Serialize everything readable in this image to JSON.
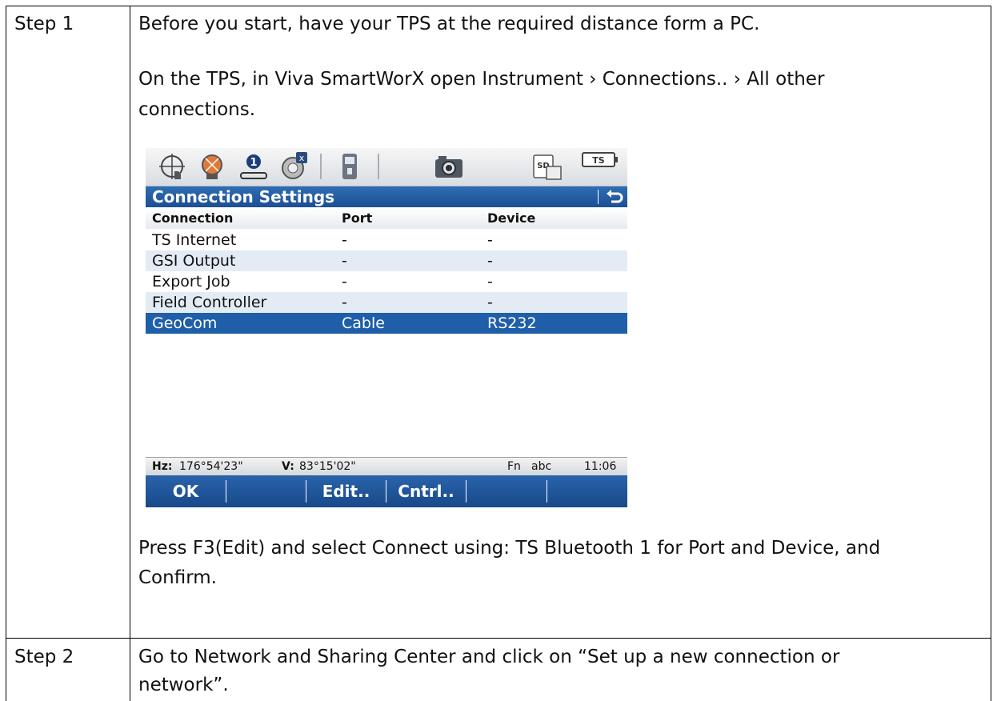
{
  "steps": [
    {
      "label": "Step 1",
      "para1": "Before you start, have your TPS at the required distance form a PC.",
      "para2_line1": "On the TPS, in Viva SmartWorX open Instrument › Connections.. › All other",
      "para2_line2": "connections.",
      "para3_line1": "Press F3(Edit) and select Connect using: TS Bluetooth 1 for Port and Device, and",
      "para3_line2": "Confirm."
    },
    {
      "label": "Step 2",
      "para1_line1": "Go to Network and Sharing Center and click on “Set up a new connection or",
      "para1_line2": "network”."
    }
  ],
  "device": {
    "toolbar_icons": [
      "target-hand-icon",
      "prism-icon",
      "user-1-icon",
      "compass-icon",
      "instrument-icon",
      "camera-icon",
      "sd-card-icon",
      "ts-battery-icon"
    ],
    "ts_badge": "TS",
    "sd_label": "SD",
    "badge_number": "1",
    "title": "Connection Settings",
    "columns": [
      "Connection",
      "Port",
      "Device"
    ],
    "rows": [
      {
        "connection": "TS Internet",
        "port": "-",
        "device": "-"
      },
      {
        "connection": "GSI Output",
        "port": "-",
        "device": "-"
      },
      {
        "connection": "Export Job",
        "port": "-",
        "device": "-"
      },
      {
        "connection": "Field Controller",
        "port": "-",
        "device": "-"
      },
      {
        "connection": "GeoCom",
        "port": "Cable",
        "device": "RS232"
      }
    ],
    "selected_row": 4,
    "status": {
      "hz_label": "Hz:",
      "hz_value": "176°54'23\"",
      "v_label": "V:",
      "v_value": "83°15'02\"",
      "fn": "Fn",
      "abc": "abc",
      "time": "11:06"
    },
    "softkeys": [
      "OK",
      "",
      "Edit..",
      "Cntrl..",
      "",
      ""
    ],
    "colors": {
      "title_bar": "#1f5ea8",
      "selected_row": "#1f5ea8",
      "alt_row": "#e3ebf5"
    }
  }
}
